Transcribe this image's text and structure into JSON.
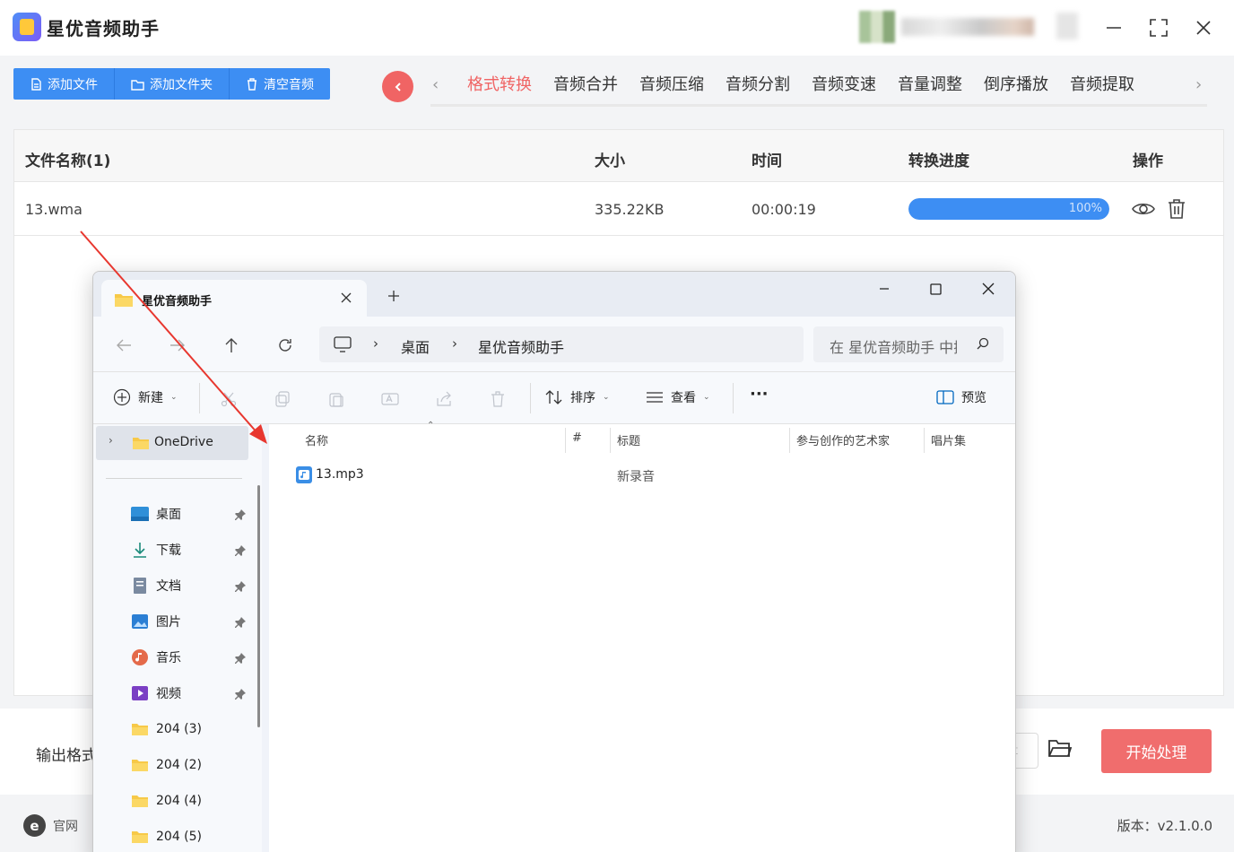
{
  "app": {
    "title": "星优音频助手",
    "toolbar": {
      "add_file": "添加文件",
      "add_folder": "添加文件夹",
      "clear": "清空音频"
    },
    "tabs": [
      "格式转换",
      "音频合并",
      "音频压缩",
      "音频分割",
      "音频变速",
      "音量调整",
      "倒序播放",
      "音频提取"
    ],
    "active_tab": "格式转换",
    "table": {
      "headers": {
        "name": "文件名称(1)",
        "size": "大小",
        "time": "时间",
        "progress": "转换进度",
        "action": "操作"
      },
      "rows": [
        {
          "name": "13.wma",
          "size": "335.22KB",
          "time": "00:00:19",
          "progress_text": "100%",
          "progress": 1.0
        }
      ]
    },
    "bottom": {
      "output_label": "输出格式",
      "output_stub": "t",
      "start": "开始处理"
    },
    "footer": {
      "site": "官网",
      "site_icon": "e",
      "version": "版本：v2.1.0.0"
    },
    "colors": {
      "accent_blue": "#3d8ef3",
      "accent_red": "#f06464",
      "start_red": "#f06d6d"
    }
  },
  "explorer": {
    "tab_title": "星优音频助手",
    "breadcrumb": [
      "桌面",
      "星优音频助手"
    ],
    "search_placeholder": "在 星优音频助手 中搜索",
    "commands": {
      "new": "新建",
      "sort": "排序",
      "view": "查看",
      "more": "···",
      "preview": "预览"
    },
    "nav": {
      "onedrive": "OneDrive",
      "pinned": [
        "桌面",
        "下载",
        "文档",
        "图片",
        "音乐",
        "视频"
      ],
      "folders": [
        "204 (3)",
        "204 (2)",
        "204 (4)",
        "204 (5)"
      ]
    },
    "columns": {
      "name": "名称",
      "number": "#",
      "title": "标题",
      "artist": "参与创作的艺术家",
      "album": "唱片集"
    },
    "files": [
      {
        "name": "13.mp3",
        "title": "新录音"
      }
    ]
  }
}
